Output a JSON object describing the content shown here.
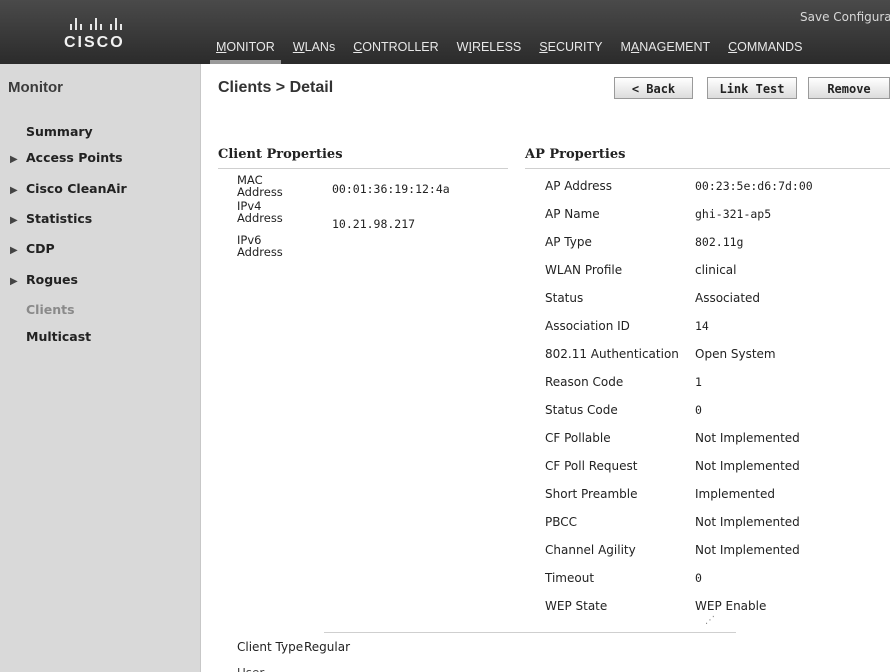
{
  "header": {
    "logo_text": "CISCO",
    "save_link": "Save Configuration",
    "nav": [
      {
        "label": "MONITOR",
        "ul": "M",
        "rest": "ONITOR"
      },
      {
        "label": "WLANs",
        "ul": "W",
        "rest": "LANs"
      },
      {
        "label": "CONTROLLER",
        "ul": "C",
        "rest": "ONTROLLER"
      },
      {
        "label": "WIRELESS",
        "pre": "W",
        "ul": "I",
        "rest": "RELESS"
      },
      {
        "label": "SECURITY",
        "ul": "S",
        "rest": "ECURITY"
      },
      {
        "label": "MANAGEMENT",
        "pre": "M",
        "ul": "A",
        "rest": "NAGEMENT"
      },
      {
        "label": "COMMANDS",
        "ul": "C",
        "rest": "OMMANDS"
      }
    ]
  },
  "sidebar": {
    "title": "Monitor",
    "items": [
      {
        "label": "Summary"
      },
      {
        "label": "Access Points"
      },
      {
        "label": "Cisco CleanAir"
      },
      {
        "label": "Statistics"
      },
      {
        "label": "CDP"
      },
      {
        "label": "Rogues"
      },
      {
        "label": "Clients"
      },
      {
        "label": "Multicast"
      }
    ]
  },
  "main": {
    "title": "Clients > Detail",
    "buttons": {
      "back": "< Back",
      "link_test": "Link Test",
      "remove": "Remove"
    },
    "client_properties": {
      "title": "Client Properties",
      "mac_label": "MAC Address",
      "mac_value": "00:01:36:19:12:4a",
      "ipv4_label": "IPv4 Address",
      "ipv4_value": "10.21.98.217",
      "ipv6_label": "IPv6 Address"
    },
    "ap_properties": {
      "title": "AP Properties",
      "rows": [
        {
          "label": "AP Address",
          "value": "00:23:5e:d6:7d:00"
        },
        {
          "label": "AP Name",
          "value": "ghi-321-ap5"
        },
        {
          "label": "AP Type",
          "value": "802.11g"
        },
        {
          "label": "WLAN Profile",
          "value": "clinical"
        },
        {
          "label": "Status",
          "value": "Associated"
        },
        {
          "label": "Association ID",
          "value": "14"
        },
        {
          "label": "802.11 Authentication",
          "value": "Open System"
        },
        {
          "label": "Reason Code",
          "value": "1"
        },
        {
          "label": "Status Code",
          "value": "0"
        },
        {
          "label": "CF Pollable",
          "value": "Not Implemented"
        },
        {
          "label": "CF Poll Request",
          "value": "Not Implemented"
        },
        {
          "label": "Short Preamble",
          "value": "Implemented"
        },
        {
          "label": "PBCC",
          "value": "Not Implemented"
        },
        {
          "label": "Channel Agility",
          "value": "Not Implemented"
        },
        {
          "label": "Timeout",
          "value": "0"
        },
        {
          "label": "WEP State",
          "value": "WEP Enable"
        }
      ]
    },
    "client_type_label": "Client Type",
    "client_type_value": "Regular",
    "cut_label": "User Name"
  }
}
